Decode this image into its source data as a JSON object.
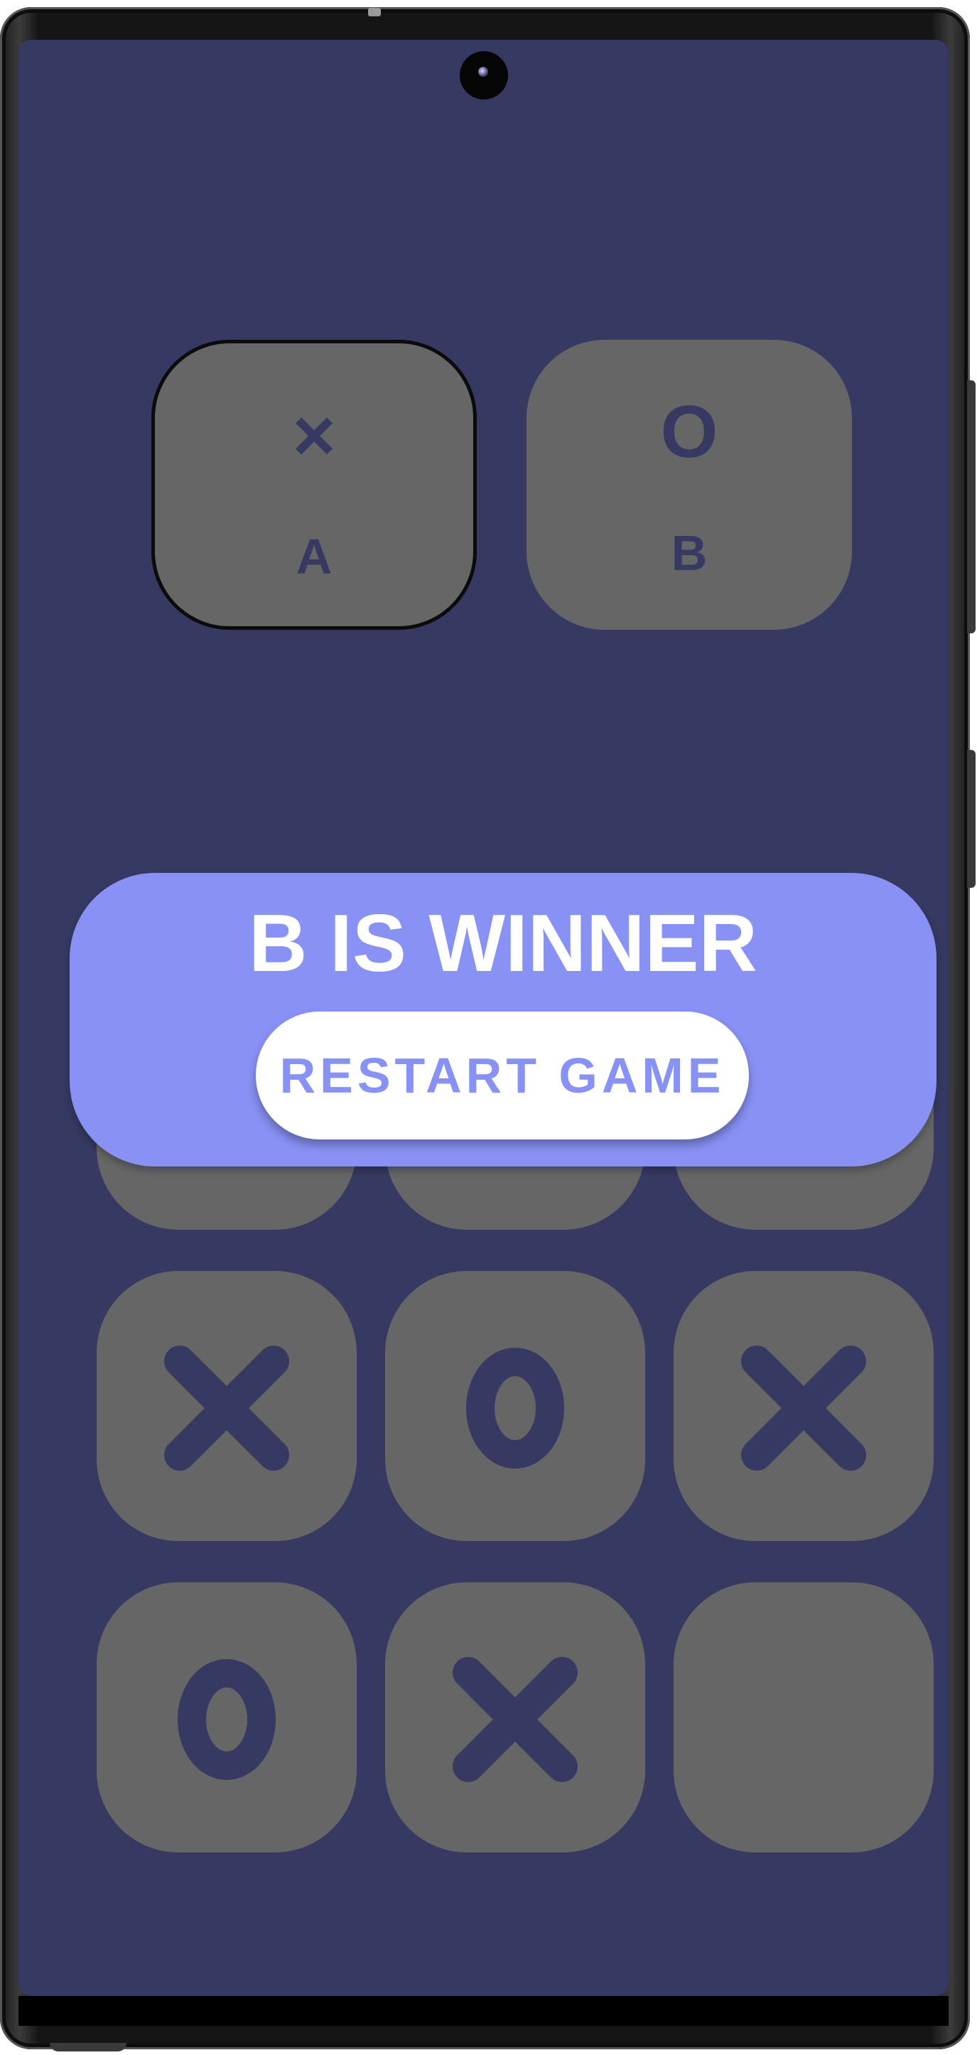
{
  "app": {
    "colors": {
      "background": "#363961",
      "card": "#666666",
      "mark": "#363961",
      "accent": "#8891f4",
      "button": "#ffffff"
    }
  },
  "players": [
    {
      "symbol": "×",
      "name": "A",
      "active": true
    },
    {
      "symbol": "O",
      "name": "B",
      "active": false
    }
  ],
  "board": {
    "cells": [
      "",
      "",
      "",
      "X",
      "O",
      "X",
      "O",
      "X",
      ""
    ]
  },
  "result": {
    "message": "B IS WINNER",
    "restart_label": "RESTART GAME"
  }
}
